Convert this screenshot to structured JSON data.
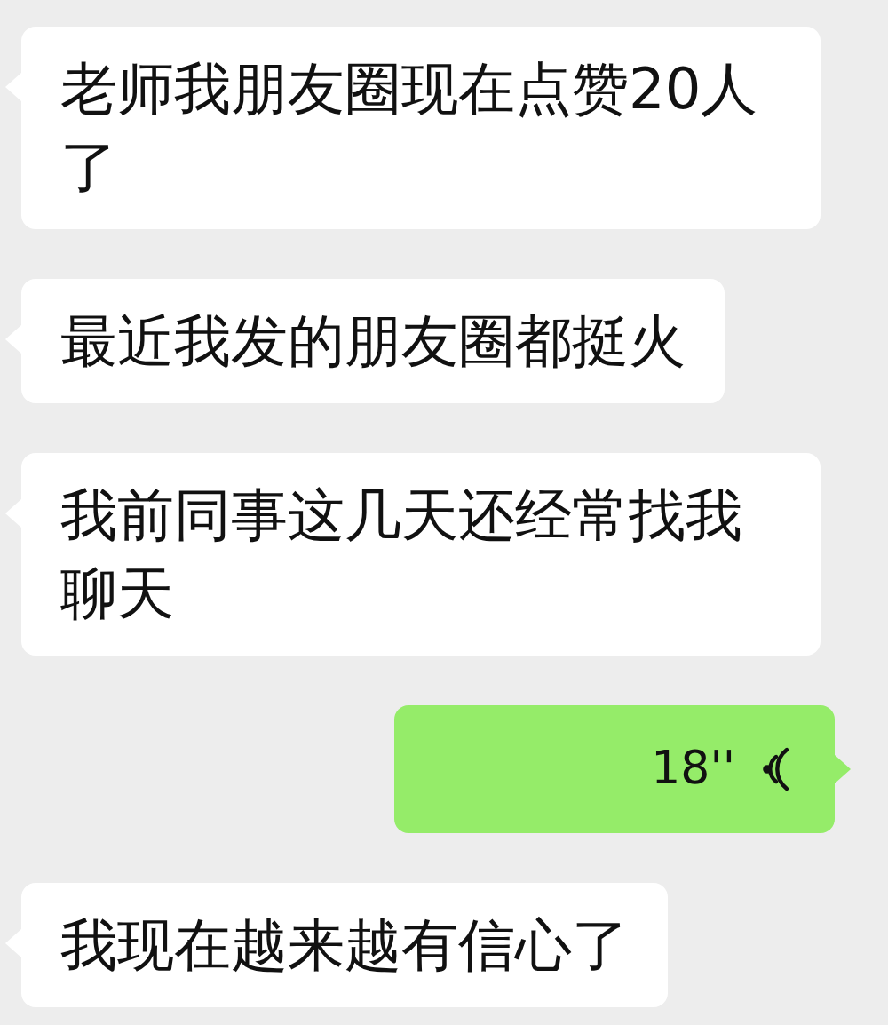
{
  "messages": [
    {
      "kind": "text",
      "text": "老师我朋友圈现在点赞20人了"
    },
    {
      "kind": "text",
      "text": "最近我发的朋友圈都挺火"
    },
    {
      "kind": "text",
      "text": "我前同事这几天还经常找我聊天"
    },
    {
      "kind": "voice",
      "duration": "18''"
    },
    {
      "kind": "text",
      "text": "我现在越来越有信心了"
    }
  ]
}
